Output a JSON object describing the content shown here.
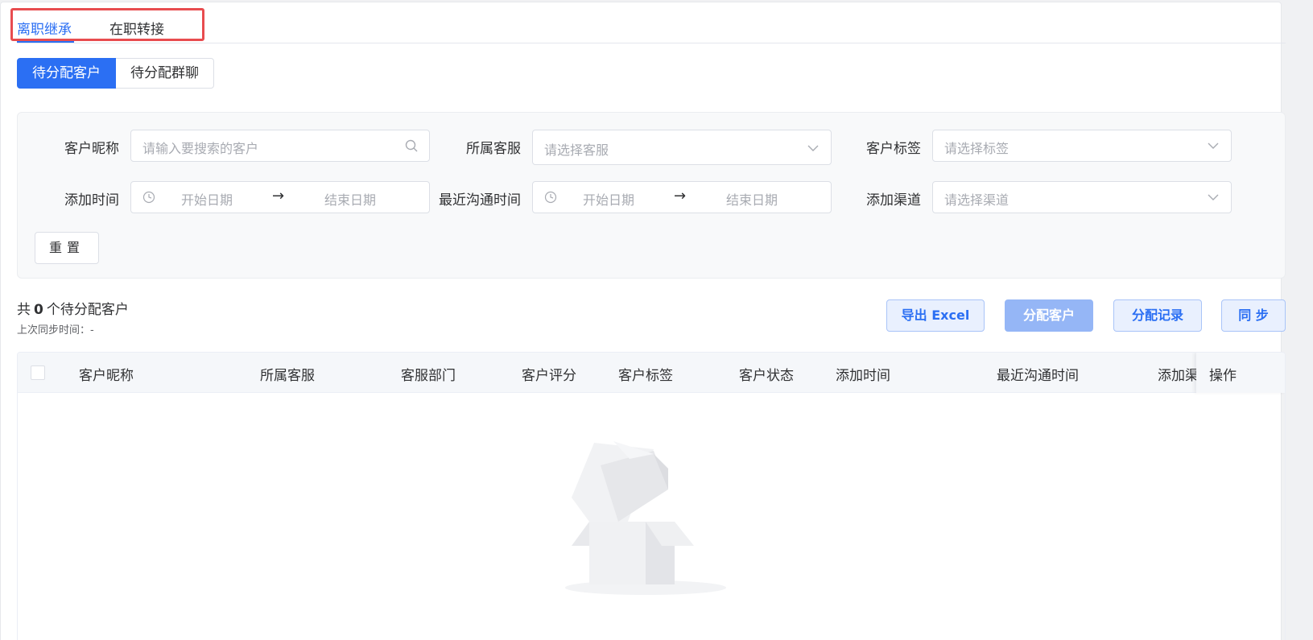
{
  "tabs": [
    {
      "label": "离职继承",
      "active": true
    },
    {
      "label": "在职转接",
      "active": false
    }
  ],
  "segments": [
    "待分配客户",
    "待分配群聊"
  ],
  "filters": {
    "nickname_label": "客户昵称",
    "nickname_placeholder": "请输入要搜索的客户",
    "service_label": "所属客服",
    "service_placeholder": "请选择客服",
    "tag_label": "客户标签",
    "tag_placeholder": "请选择标签",
    "add_time_label": "添加时间",
    "add_time_start": "开始日期",
    "add_time_end": "结束日期",
    "last_contact_label": "最近沟通时间",
    "last_contact_start": "开始日期",
    "last_contact_end": "结束日期",
    "channel_label": "添加渠道",
    "channel_placeholder": "请选择渠道",
    "range_arrow": "→",
    "reset_label": "重置"
  },
  "summary": {
    "prefix": "共",
    "count": "0",
    "suffix": "个待分配客户",
    "sync_time": "上次同步时间：-"
  },
  "actions": {
    "export": "导出 Excel",
    "assign": "分配客户",
    "records": "分配记录",
    "sync": "同 步"
  },
  "table": {
    "columns": [
      "客户昵称",
      "所属客服",
      "客服部门",
      "客户评分",
      "客户标签",
      "客户状态",
      "添加时间",
      "最近沟通时间",
      "添加渠",
      "操作"
    ]
  },
  "colors": {
    "primary": "#2b6ff3",
    "highlight": "#e84c4f"
  },
  "icons": [
    "search-icon",
    "chevron-down-icon",
    "clock-icon",
    "empty-box-icon"
  ]
}
